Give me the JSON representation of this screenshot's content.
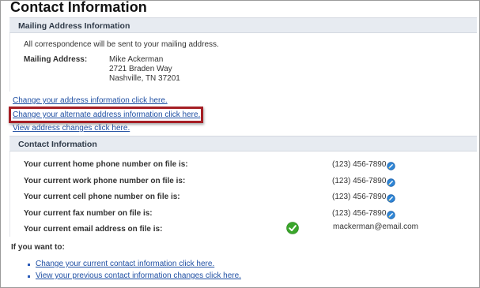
{
  "page": {
    "title": "Contact Information"
  },
  "mailing_section": {
    "header": "Mailing Address Information",
    "note": "All correspondence will be sent to your mailing address.",
    "label": "Mailing Address:",
    "address_lines": [
      "Mike Ackerman",
      "2721 Braden Way",
      "Nashville, TN 37201"
    ]
  },
  "links": {
    "change_address": "Change your address information click here.",
    "change_alternate": "Change your alternate address information click here.",
    "view_address_changes": "View address changes click here."
  },
  "contact_section": {
    "header": "Contact Information",
    "rows": [
      {
        "label": "Your current home phone number on file is:",
        "value": "(123) 456-7890"
      },
      {
        "label": "Your current work phone number on file is:",
        "value": "(123) 456-7890"
      },
      {
        "label": "Your current cell phone number on file is:",
        "value": "(123) 456-7890"
      },
      {
        "label": "Your current fax number on file is:",
        "value": "(123) 456-7890"
      },
      {
        "label": "Your current email address on file is:",
        "value": "mackerman@email.com"
      }
    ]
  },
  "if_you_want": {
    "label": "If you want to:",
    "links": [
      "Change your current contact information click here.",
      "View your previous contact information changes click here."
    ]
  },
  "icons": {
    "edit": "edit-phone-icon",
    "verified": "verified-check-icon"
  },
  "colors": {
    "link": "#1f4fa3",
    "highlight": "#a51e24",
    "section_header_bg": "#e7ebf1",
    "check_green": "#3aa62b"
  }
}
